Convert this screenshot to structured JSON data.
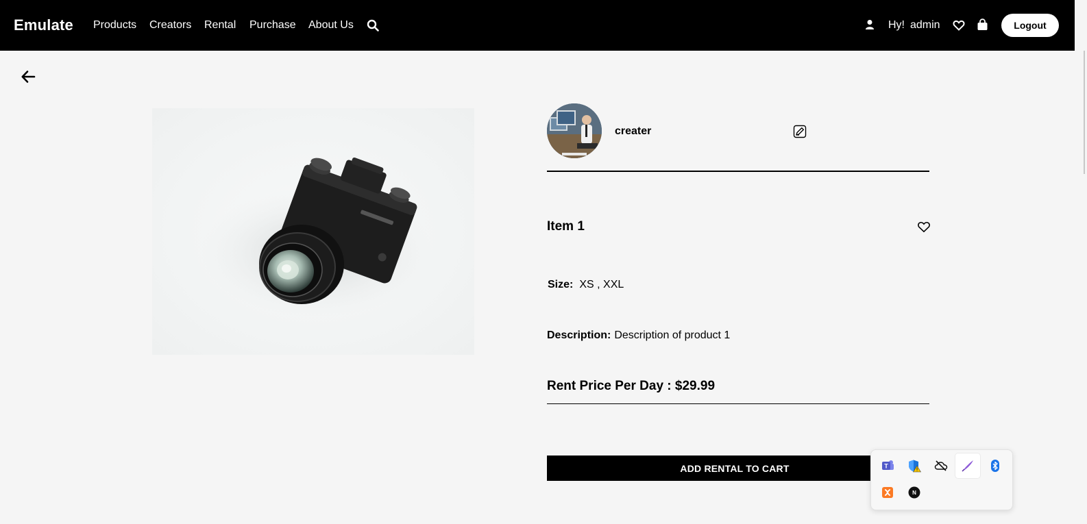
{
  "brand": "Emulate",
  "nav": {
    "links": [
      "Products",
      "Creators",
      "Rental",
      "Purchase",
      "About Us"
    ],
    "greeting": "Hy!",
    "username": "admin",
    "logout_label": "Logout"
  },
  "product": {
    "creator_name": "creater",
    "title": "Item 1",
    "size_label": "Size:",
    "sizes": "XS ,  XXL",
    "description_label": "Description:",
    "description": "Description of product 1",
    "price_label": "Rent Price Per Day : $29.99",
    "add_to_cart_label": "ADD RENTAL TO CART"
  },
  "tray": {
    "icons": [
      "teams-icon",
      "defender-warning-icon",
      "onedrive-offline-icon",
      "pen-icon",
      "bluetooth-icon",
      "xampp-icon",
      "app-icon"
    ]
  },
  "colors": {
    "navbar": "#000000",
    "background": "#f5f5f5",
    "accent": "#000000"
  }
}
